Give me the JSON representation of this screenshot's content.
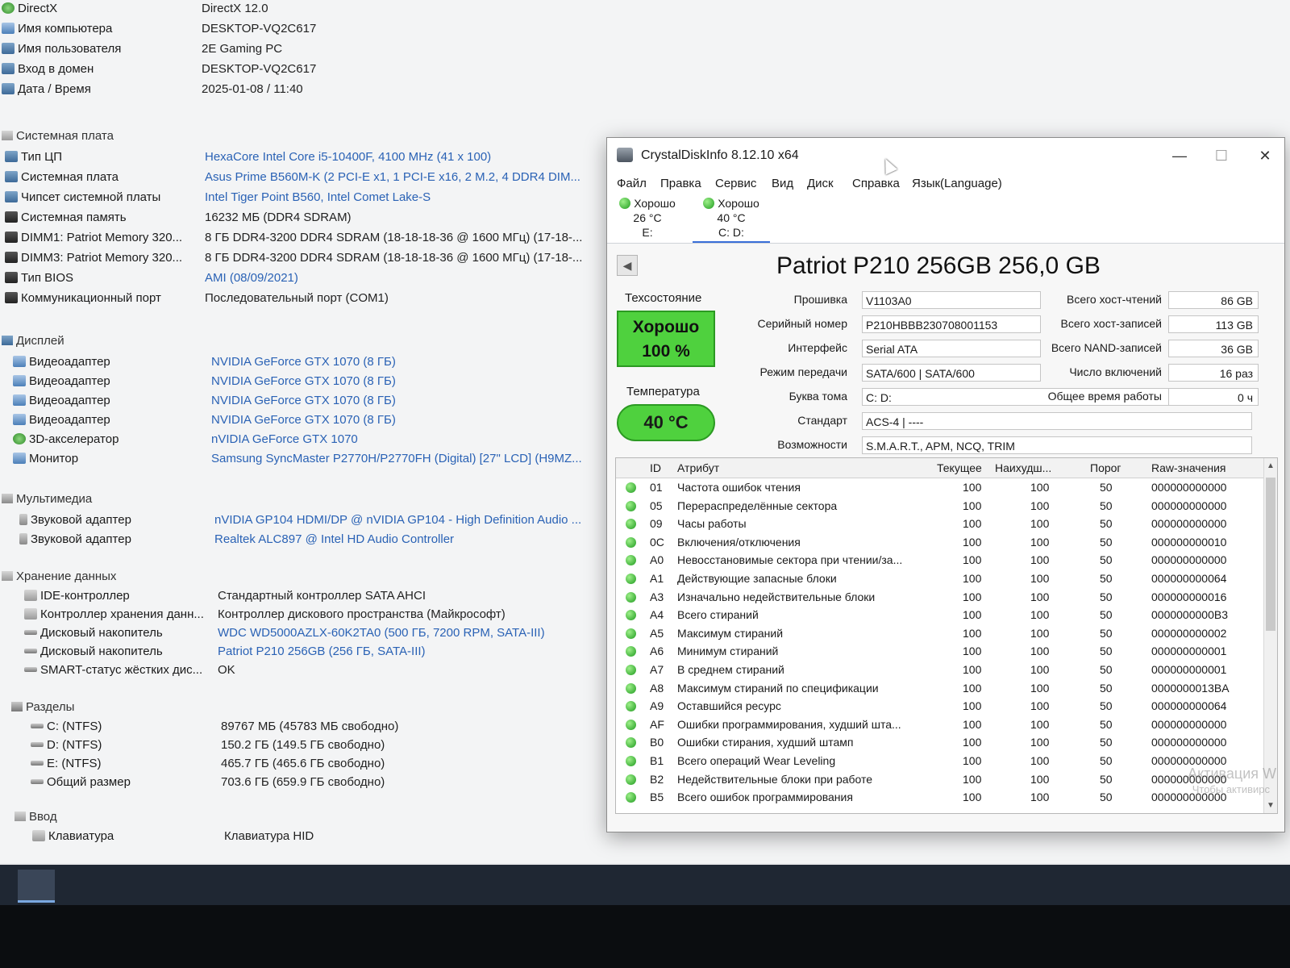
{
  "sysinfo": {
    "top": [
      {
        "label": "DirectX",
        "value": "DirectX 12.0",
        "icon": "directx-icon"
      },
      {
        "label": "Имя компьютера",
        "value": "DESKTOP-VQ2C617",
        "icon": "computer-icon"
      },
      {
        "label": "Имя пользователя",
        "value": "2E Gaming PC",
        "icon": "user-icon"
      },
      {
        "label": "Вход в домен",
        "value": "DESKTOP-VQ2C617",
        "icon": "domain-icon"
      },
      {
        "label": "Дата / Время",
        "value": "2025-01-08 / 11:40",
        "icon": "clock-icon"
      }
    ],
    "motherboard_section": "Системная плата",
    "motherboard": [
      {
        "label": "Тип ЦП",
        "value": "HexaCore Intel Core i5-10400F, 4100 MHz (41 x 100)",
        "link": true
      },
      {
        "label": "Системная плата",
        "value": "Asus Prime B560M-K  (2 PCI-E x1, 1 PCI-E x16, 2 M.2, 4 DDR4 DIM...",
        "link": true
      },
      {
        "label": "Чипсет системной платы",
        "value": "Intel Tiger Point B560, Intel Comet Lake-S",
        "link": true
      },
      {
        "label": "Системная память",
        "value": "16232 МБ  (DDR4 SDRAM)",
        "link": false
      },
      {
        "label": "DIMM1: Patriot Memory 320...",
        "value": "8 ГБ DDR4-3200 DDR4 SDRAM  (18-18-18-36 @ 1600 МГц)  (17-18-...",
        "link": false
      },
      {
        "label": "DIMM3: Patriot Memory 320...",
        "value": "8 ГБ DDR4-3200 DDR4 SDRAM  (18-18-18-36 @ 1600 МГц)  (17-18-...",
        "link": false
      },
      {
        "label": "Тип BIOS",
        "value": "AMI (08/09/2021)",
        "link": true
      },
      {
        "label": "Коммуникационный порт",
        "value": "Последовательный порт (COM1)",
        "link": false
      }
    ],
    "display_section": "Дисплей",
    "display": [
      {
        "label": "Видеоадаптер",
        "value": "NVIDIA GeForce GTX 1070  (8 ГБ)"
      },
      {
        "label": "Видеоадаптер",
        "value": "NVIDIA GeForce GTX 1070  (8 ГБ)"
      },
      {
        "label": "Видеоадаптер",
        "value": "NVIDIA GeForce GTX 1070  (8 ГБ)"
      },
      {
        "label": "Видеоадаптер",
        "value": "NVIDIA GeForce GTX 1070  (8 ГБ)"
      },
      {
        "label": "3D-акселератор",
        "value": "nVIDIA GeForce GTX 1070"
      },
      {
        "label": "Монитор",
        "value": "Samsung SyncMaster P2770H/P2770FH (Digital)  [27\" LCD]  (H9MZ..."
      }
    ],
    "multimedia_section": "Мультимедиа",
    "multimedia": [
      {
        "label": "Звуковой адаптер",
        "value": "nVIDIA GP104 HDMI/DP @ nVIDIA GP104 - High Definition Audio ..."
      },
      {
        "label": "Звуковой адаптер",
        "value": "Realtek ALC897 @ Intel HD Audio Controller"
      }
    ],
    "storage_section": "Хранение данных",
    "storage": [
      {
        "label": "IDE-контроллер",
        "value": "Стандартный контроллер SATA AHCI",
        "link": false
      },
      {
        "label": "Контроллер хранения данн...",
        "value": "Контроллер дискового пространства (Майкрософт)",
        "link": false
      },
      {
        "label": "Дисковый накопитель",
        "value": "WDC WD5000AZLX-60K2TA0  (500 ГБ, 7200 RPM, SATA-III)",
        "link": true
      },
      {
        "label": "Дисковый накопитель",
        "value": "Patriot P210 256GB  (256 ГБ, SATA-III)",
        "link": true
      },
      {
        "label": "SMART-статус жёстких дис...",
        "value": "OK",
        "link": false
      }
    ],
    "partitions_section": "Разделы",
    "partitions": [
      {
        "label": "C: (NTFS)",
        "value": "89767 МБ (45783 МБ свободно)"
      },
      {
        "label": "D: (NTFS)",
        "value": "150.2 ГБ (149.5 ГБ свободно)"
      },
      {
        "label": "E: (NTFS)",
        "value": "465.7 ГБ (465.6 ГБ свободно)"
      },
      {
        "label": "Общий размер",
        "value": "703.6 ГБ (659.9 ГБ свободно)"
      }
    ],
    "input_section": "Ввод",
    "input": [
      {
        "label": "Клавиатура",
        "value": "Клавиатура HID"
      }
    ]
  },
  "cdi": {
    "title": "CrystalDiskInfo 8.12.10 x64",
    "window_buttons": {
      "minimize": "—",
      "maximize": "☐",
      "close": "✕"
    },
    "menu": [
      "Файл",
      "Правка",
      "Сервис",
      "Вид",
      "Диск",
      "Справка",
      "Язык(Language)"
    ],
    "drives": [
      {
        "status": "Хорошо",
        "temp": "26 °C",
        "letter": "E:"
      },
      {
        "status": "Хорошо",
        "temp": "40 °C",
        "letter": "C: D:"
      }
    ],
    "model": "Patriot P210 256GB 256,0 GB",
    "health_label": "Техсостояние",
    "health_status": "Хорошо",
    "health_percent": "100 %",
    "temp_label": "Температура",
    "temp_value": "40 °C",
    "fields": [
      {
        "label": "Прошивка",
        "value": "V1103A0"
      },
      {
        "label": "Серийный номер",
        "value": "P210HBBB230708001153"
      },
      {
        "label": "Интерфейс",
        "value": "Serial ATA"
      },
      {
        "label": "Режим передачи",
        "value": "SATA/600 | SATA/600"
      },
      {
        "label": "Буква тома",
        "value": "C: D:"
      },
      {
        "label": "Стандарт",
        "value": "ACS-4 | ----"
      },
      {
        "label": "Возможности",
        "value": "S.M.A.R.T., APM, NCQ, TRIM"
      }
    ],
    "stats": [
      {
        "label": "Всего хост-чтений",
        "value": "86 GB"
      },
      {
        "label": "Всего хост-записей",
        "value": "113 GB"
      },
      {
        "label": "Всего NAND-записей",
        "value": "36 GB"
      },
      {
        "label": "Число включений",
        "value": "16 раз"
      },
      {
        "label": "Общее время работы",
        "value": "0 ч"
      }
    ],
    "smart_headers": {
      "id": "ID",
      "attr": "Атрибут",
      "cur": "Текущее",
      "worst": "Наихудш...",
      "thr": "Порог",
      "raw": "Raw-значения"
    },
    "smart_rows": [
      {
        "id": "01",
        "attr": "Частота ошибок чтения",
        "cur": "100",
        "worst": "100",
        "thr": "50",
        "raw": "000000000000"
      },
      {
        "id": "05",
        "attr": "Перераспределённые сектора",
        "cur": "100",
        "worst": "100",
        "thr": "50",
        "raw": "000000000000"
      },
      {
        "id": "09",
        "attr": "Часы работы",
        "cur": "100",
        "worst": "100",
        "thr": "50",
        "raw": "000000000000"
      },
      {
        "id": "0C",
        "attr": "Включения/отключения",
        "cur": "100",
        "worst": "100",
        "thr": "50",
        "raw": "000000000010"
      },
      {
        "id": "A0",
        "attr": "Невосстановимые сектора при чтении/за...",
        "cur": "100",
        "worst": "100",
        "thr": "50",
        "raw": "000000000000"
      },
      {
        "id": "A1",
        "attr": "Действующие запасные блоки",
        "cur": "100",
        "worst": "100",
        "thr": "50",
        "raw": "000000000064"
      },
      {
        "id": "A3",
        "attr": "Изначально недействительные блоки",
        "cur": "100",
        "worst": "100",
        "thr": "50",
        "raw": "000000000016"
      },
      {
        "id": "A4",
        "attr": "Всего стираний",
        "cur": "100",
        "worst": "100",
        "thr": "50",
        "raw": "0000000000B3"
      },
      {
        "id": "A5",
        "attr": "Максимум стираний",
        "cur": "100",
        "worst": "100",
        "thr": "50",
        "raw": "000000000002"
      },
      {
        "id": "A6",
        "attr": "Минимум стираний",
        "cur": "100",
        "worst": "100",
        "thr": "50",
        "raw": "000000000001"
      },
      {
        "id": "A7",
        "attr": "В среднем стираний",
        "cur": "100",
        "worst": "100",
        "thr": "50",
        "raw": "000000000001"
      },
      {
        "id": "A8",
        "attr": "Максимум стираний по спецификации",
        "cur": "100",
        "worst": "100",
        "thr": "50",
        "raw": "0000000013BA"
      },
      {
        "id": "A9",
        "attr": "Оставшийся ресурс",
        "cur": "100",
        "worst": "100",
        "thr": "50",
        "raw": "000000000064"
      },
      {
        "id": "AF",
        "attr": "Ошибки программирования, худший шта...",
        "cur": "100",
        "worst": "100",
        "thr": "50",
        "raw": "000000000000"
      },
      {
        "id": "B0",
        "attr": "Ошибки стирания, худший штамп",
        "cur": "100",
        "worst": "100",
        "thr": "50",
        "raw": "000000000000"
      },
      {
        "id": "B1",
        "attr": "Всего операций Wear Leveling",
        "cur": "100",
        "worst": "100",
        "thr": "50",
        "raw": "000000000000"
      },
      {
        "id": "B2",
        "attr": "Недействительные блоки при работе",
        "cur": "100",
        "worst": "100",
        "thr": "50",
        "raw": "000000000000"
      },
      {
        "id": "B5",
        "attr": "Всего ошибок программирования",
        "cur": "100",
        "worst": "100",
        "thr": "50",
        "raw": "000000000000"
      }
    ]
  },
  "watermark": {
    "line1": "Активация W",
    "line2": "Чтобы активирс"
  },
  "colors": {
    "good": "#4fd13e",
    "link": "#2a62b5",
    "selected_tab": "#3a6fd8"
  }
}
